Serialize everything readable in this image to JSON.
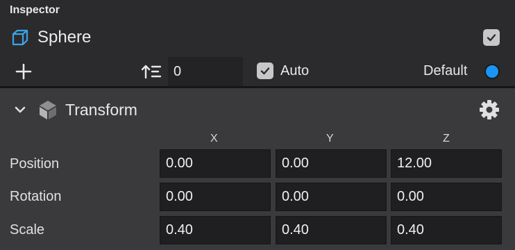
{
  "inspector": {
    "title": "Inspector",
    "object": {
      "name": "Sphere",
      "icon": "cube-outline-icon",
      "active": true
    },
    "order": {
      "value": "0",
      "icon": "sort-order-icon"
    },
    "auto": {
      "label": "Auto",
      "checked": true
    },
    "default": {
      "label": "Default",
      "selected": true,
      "color": "#1a94f5"
    }
  },
  "transform": {
    "title": "Transform",
    "expanded": true,
    "axes": [
      "X",
      "Y",
      "Z"
    ],
    "rows": [
      {
        "label": "Position",
        "values": [
          "0.00",
          "0.00",
          "12.00"
        ]
      },
      {
        "label": "Rotation",
        "values": [
          "0.00",
          "0.00",
          "0.00"
        ]
      },
      {
        "label": "Scale",
        "values": [
          "0.40",
          "0.40",
          "0.40"
        ]
      }
    ]
  }
}
